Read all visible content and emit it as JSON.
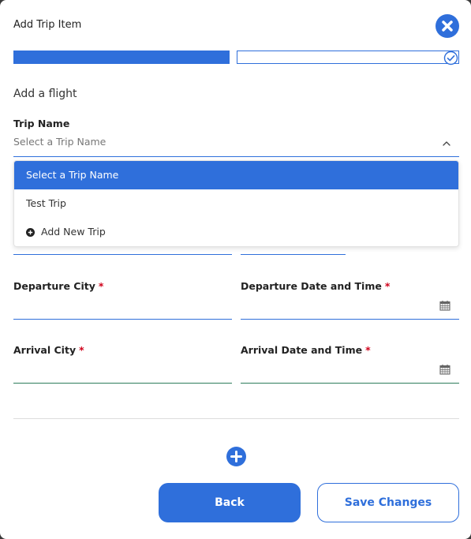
{
  "modal": {
    "title": "Add Trip Item",
    "section_heading": "Add a flight"
  },
  "colors": {
    "accent": "#2f6fdb",
    "required": "#d0021b",
    "valid_underline": "#2e7d5b"
  },
  "icons": {
    "close": "close-icon",
    "step_check": "check-circle-icon",
    "chevron": "chevron-up-icon",
    "calendar": "calendar-icon",
    "add": "plus-circle-icon"
  },
  "trip_name": {
    "label": "Trip Name",
    "placeholder": "Select a Trip Name",
    "options": [
      {
        "label": "Select a Trip Name",
        "selected": true
      },
      {
        "label": "Test Trip",
        "selected": false
      },
      {
        "label": "Add New Trip",
        "selected": false
      }
    ]
  },
  "fields": {
    "departure_city": {
      "label": "Departure City",
      "required_mark": "*",
      "value": ""
    },
    "departure_datetime": {
      "label": "Departure Date and Time",
      "required_mark": "*",
      "value": ""
    },
    "arrival_city": {
      "label": "Arrival City",
      "required_mark": "*",
      "value": ""
    },
    "arrival_datetime": {
      "label": "Arrival Date and Time",
      "required_mark": "*",
      "value": ""
    }
  },
  "buttons": {
    "back": "Back",
    "save": "Save Changes"
  }
}
